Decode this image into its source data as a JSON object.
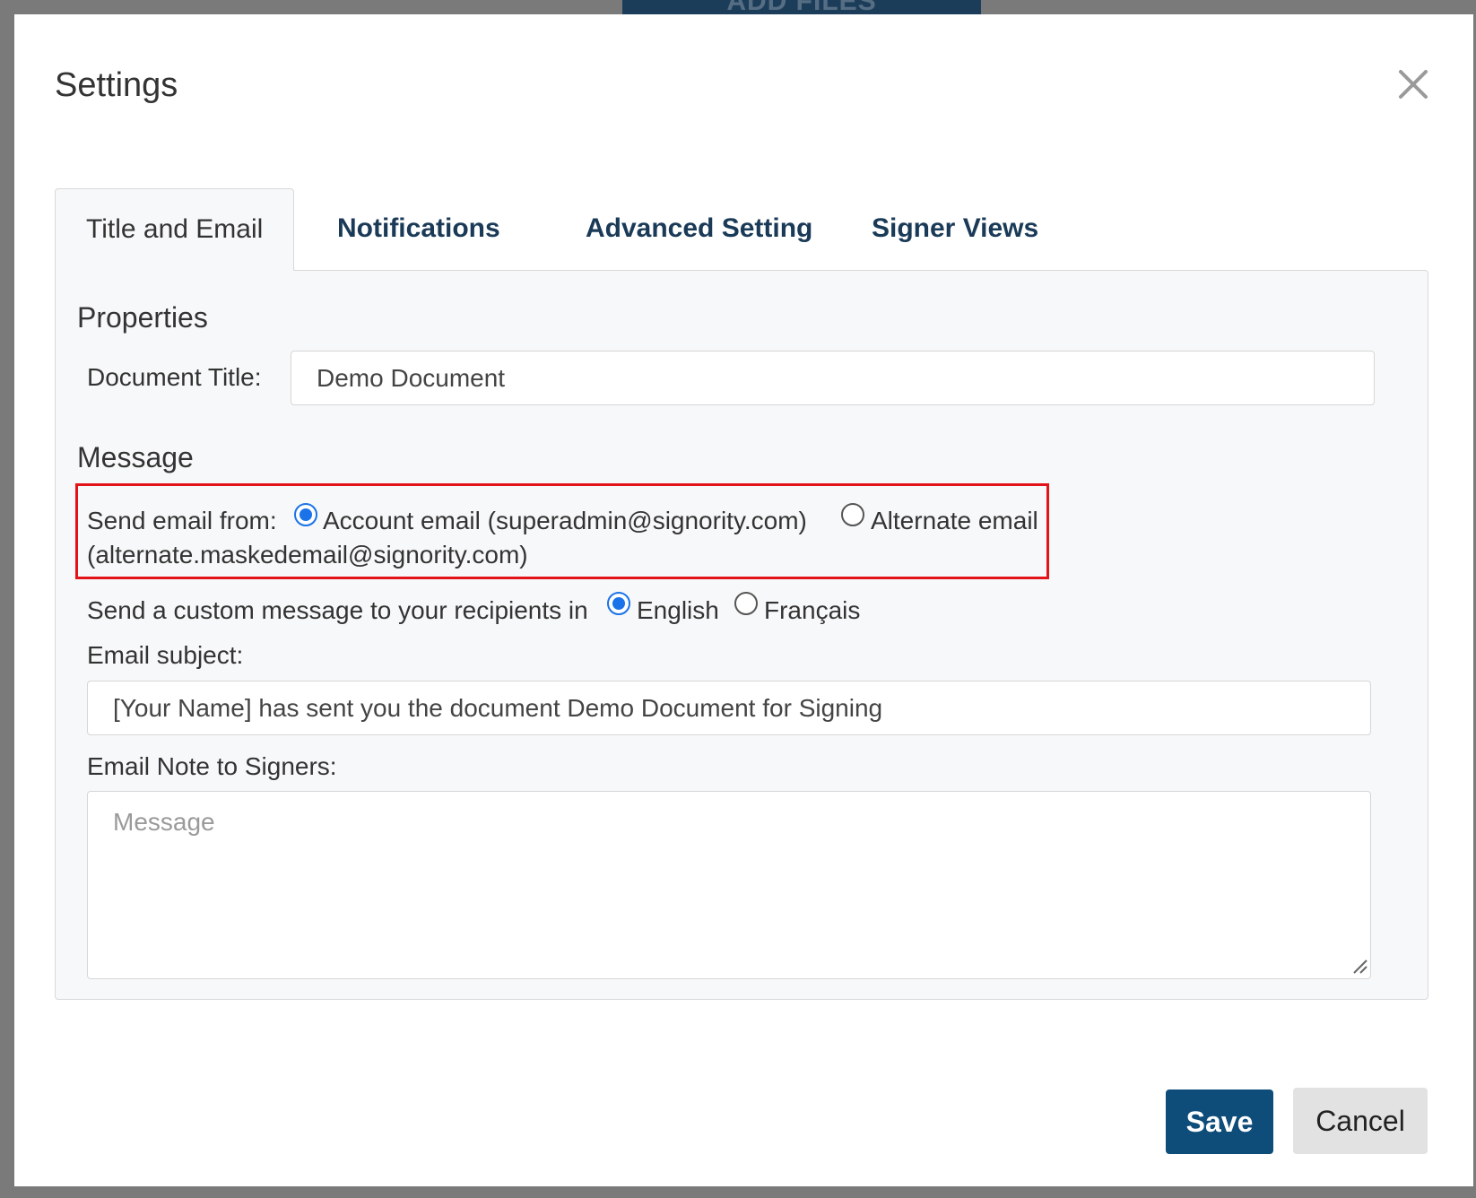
{
  "background": {
    "add_files_label": "ADD FILES"
  },
  "dialog": {
    "title": "Settings",
    "close_icon": "close-icon"
  },
  "tabs": [
    {
      "label": "Title and Email",
      "active": true
    },
    {
      "label": "Notifications",
      "active": false
    },
    {
      "label": "Advanced Setting",
      "active": false
    },
    {
      "label": "Signer Views",
      "active": false
    }
  ],
  "properties": {
    "heading": "Properties",
    "document_title_label": "Document Title:",
    "document_title_value": "Demo Document"
  },
  "message": {
    "heading": "Message",
    "send_from_label": "Send email from:",
    "account_email_label": "Account email (superadmin@signority.com)",
    "alternate_email_label": "Alternate email",
    "alternate_email_value": "(alternate.maskedemail@signority.com)",
    "selected_sender": "account",
    "language_label": "Send a custom message to your recipients in",
    "language_options": [
      "English",
      "Français"
    ],
    "selected_language": "English",
    "subject_label": "Email subject:",
    "subject_value": "[Your Name] has sent you the document Demo Document for Signing",
    "note_label": "Email Note to Signers:",
    "note_placeholder": "Message"
  },
  "footer": {
    "save_label": "Save",
    "cancel_label": "Cancel"
  },
  "colors": {
    "primary": "#0e4c79",
    "tab_text": "#1a3a57",
    "highlight": "#e3131a",
    "radio_checked": "#1a73e8"
  }
}
